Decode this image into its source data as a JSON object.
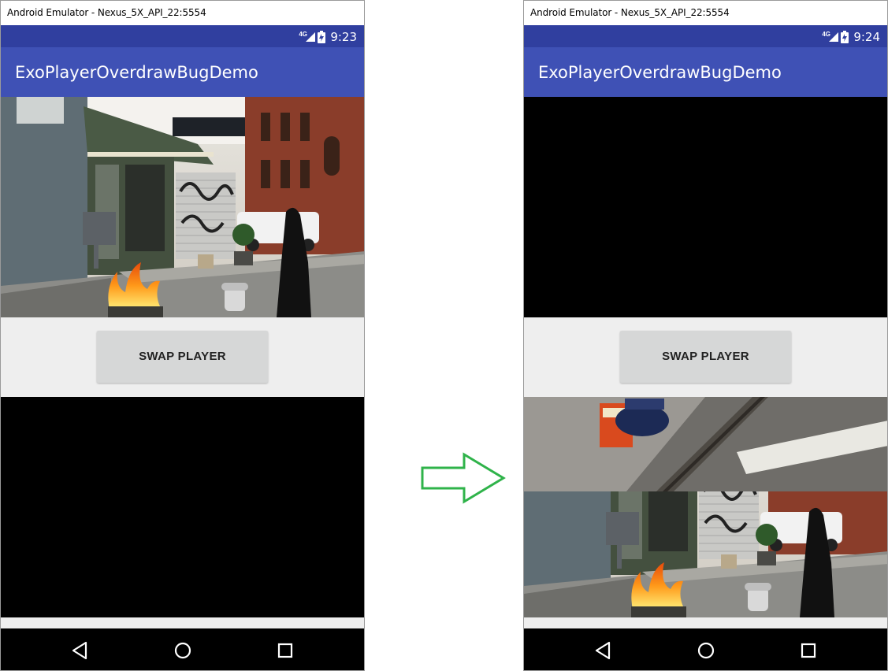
{
  "colors": {
    "status_bar": "#303f9f",
    "app_bar": "#3f51b5",
    "content_bg": "#eeeeee",
    "button_bg": "#d6d7d7",
    "arrow": "#2fb34a",
    "nav_bar": "#000000"
  },
  "left": {
    "window_title": "Android Emulator - Nexus_5X_API_22:5554",
    "network": "4G",
    "time": "9:23",
    "app_title": "ExoPlayerOverdrawBugDemo",
    "button_label": "SWAP PLAYER",
    "top_player": "video: street scene",
    "bottom_player": "black"
  },
  "right": {
    "window_title": "Android Emulator - Nexus_5X_API_22:5554",
    "network": "4G",
    "time": "9:24",
    "app_title": "ExoPlayerOverdrawBugDemo",
    "button_label": "SWAP PLAYER",
    "top_player": "black",
    "bottom_player": "video: street scene (overdrawn)"
  },
  "nav": {
    "back": "back-triangle-icon",
    "home": "home-circle-icon",
    "recents": "recents-square-icon"
  },
  "transition_arrow": "right-arrow-icon"
}
